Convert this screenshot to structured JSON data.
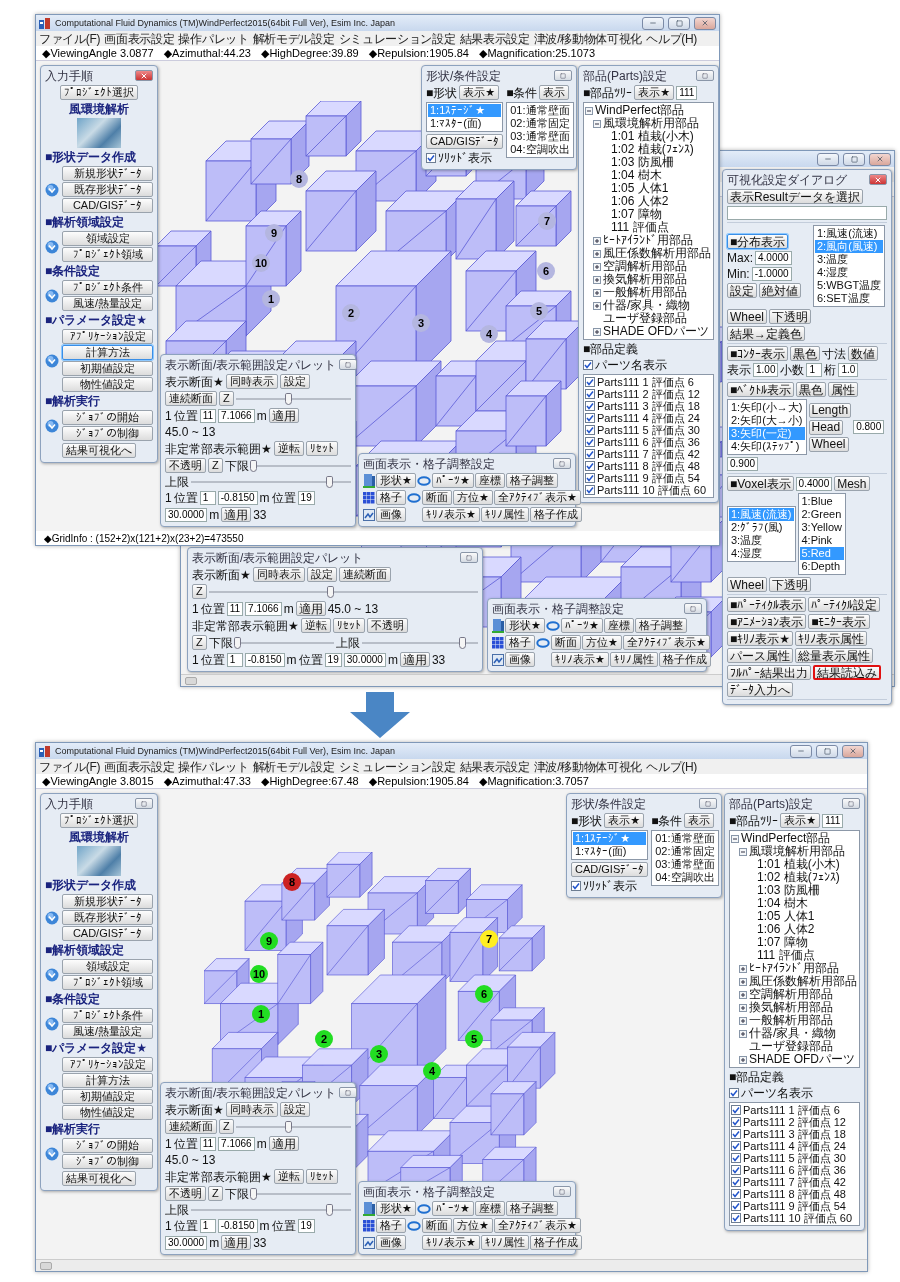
{
  "screens": [
    {
      "title": "Computational Fluid Dynamics (TM)WindPerfect2015(64bit Full Ver), Esim Inc. Japan",
      "menu": [
        "ファイル(F)",
        "画面表示設定",
        "操作パレット",
        "解析モデル設定",
        "シミュレーション設定",
        "結果表示設定",
        "津波/移動物体可視化",
        "ヘルプ(H)"
      ],
      "info": [
        "◆ViewingAngle 3.0877",
        "◆Azimuthal:44.23",
        "◆HighDegree:39.89",
        "◆Repulsion:1905.84",
        "◆Magnification:25.1073"
      ],
      "input_panel": {
        "title": "入力手順",
        "close_highlighted": true,
        "project_button": "ﾌﾟﾛｼﾞｪｸﾄ選択",
        "analysis_type": "風環境解析",
        "sections": [
          {
            "heading": "■形状データ作成",
            "buttons": [
              {
                "label": "新規形状ﾃﾞｰﾀ",
                "selected": false
              },
              {
                "label": "既存形状ﾃﾞｰﾀ",
                "selected": false
              },
              {
                "label": "CAD/GISﾃﾞｰﾀ",
                "selected": false
              }
            ]
          },
          {
            "heading": "■解析領域設定",
            "buttons": [
              {
                "label": "領域設定",
                "selected": false
              },
              {
                "label": "ﾌﾟﾛｼﾞｪｸﾄ領域",
                "selected": false
              }
            ]
          },
          {
            "heading": "■条件設定",
            "buttons": [
              {
                "label": "ﾌﾟﾛｼﾞｪｸﾄ条件",
                "selected": false
              },
              {
                "label": "風速/熱量設定",
                "selected": false
              }
            ]
          },
          {
            "heading": "■パラメータ設定★",
            "buttons": [
              {
                "label": "ｱﾌﾟﾘｹｰｼｮﾝ設定",
                "selected": false
              },
              {
                "label": "計算方法",
                "selected": true
              },
              {
                "label": "初期値設定",
                "selected": false
              },
              {
                "label": "物性値設定",
                "selected": false
              }
            ]
          },
          {
            "heading": "■解析実行",
            "buttons": [
              {
                "label": "ｼﾞｮﾌﾞの開始",
                "selected": false
              },
              {
                "label": "ｼﾞｮﾌﾞの制御",
                "selected": false
              }
            ]
          }
        ],
        "finish_button": "結果可視化へ"
      },
      "shape_panel": {
        "title": "形状/条件設定",
        "shape_heading": "■形状",
        "shape_button": "表示★",
        "condition_heading": "■条件",
        "condition_button": "表示",
        "shapes": [
          {
            "label": "1:1ｽﾃｰｼﾞ★",
            "selected": true
          },
          {
            "label": "1:ﾏｽﾀｰ(面)",
            "selected": false
          }
        ],
        "conditions": [
          {
            "label": "01:通常壁面",
            "selected": false
          },
          {
            "label": "02:通常固定",
            "selected": false
          },
          {
            "label": "03:通常壁面",
            "selected": false
          },
          {
            "label": "04:空調吹出",
            "selected": false
          }
        ],
        "cad_button": "CAD/GISﾃﾞｰﾀ",
        "solid_display": {
          "label": "ｿﾘｯﾄﾞ表示",
          "checked": true
        }
      },
      "parts_panel": {
        "title": "部品(Parts)設定",
        "tree_heading": "■部品ﾂﾘｰ",
        "tree_button": "表示★",
        "filter_value": "111",
        "tree": [
          {
            "label": "WindPerfect部品",
            "expanded": true,
            "children": [
              {
                "label": "風環境解析用部品",
                "expanded": true,
                "children": [
                  {
                    "label": "1:01 植栽(小木)"
                  },
                  {
                    "label": "1:02 植栽(ﾌｪﾝｽ)"
                  },
                  {
                    "label": "1:03 防風柵"
                  },
                  {
                    "label": "1:04 樹木"
                  },
                  {
                    "label": "1:05 人体1"
                  },
                  {
                    "label": "1:06 人体2"
                  },
                  {
                    "label": "1:07 障物"
                  },
                  {
                    "label": "111 評価点"
                  }
                ]
              },
              {
                "label": "ﾋｰﾄｱｲﾗﾝﾄﾞ用部品",
                "expanded": false
              },
              {
                "label": "風圧係数解析用部品",
                "expanded": false
              },
              {
                "label": "空調解析用部品",
                "expanded": false
              },
              {
                "label": "換気解析用部品",
                "expanded": false
              },
              {
                "label": "一般解析用部品",
                "expanded": false
              },
              {
                "label": "什器/家具・織物",
                "expanded": false
              },
              {
                "label": "ユーザ登録部品"
              },
              {
                "label": "SHADE OFDパーツ",
                "expanded": false
              }
            ]
          }
        ],
        "definition_heading": "■部品定義",
        "show_names": {
          "label": "パーツ名表示",
          "checked": true
        },
        "parts": [
          {
            "label": "Parts111 1 評価点 6",
            "checked": true
          },
          {
            "label": "Parts111 2 評価点 12",
            "checked": true
          },
          {
            "label": "Parts111 3 評価点 18",
            "checked": true
          },
          {
            "label": "Parts111 4 評価点 24",
            "checked": true
          },
          {
            "label": "Parts111 5 評価点 30",
            "checked": true
          },
          {
            "label": "Parts111 6 評価点 36",
            "checked": true
          },
          {
            "label": "Parts111 7 評価点 42",
            "checked": true
          },
          {
            "label": "Parts111 8 評価点 48",
            "checked": true
          },
          {
            "label": "Parts111 9 評価点 54",
            "checked": true
          },
          {
            "label": "Parts111 10 評価点 60",
            "checked": true
          }
        ]
      },
      "palette": {
        "title": "表示断面/表示範囲設定パレット",
        "groups": [
          {
            "heading": "表示断面★",
            "buttons": [
              "同時表示",
              "設定",
              "連続断面"
            ],
            "sliders": [
              {
                "z": "Z",
                "level": 0.45
              }
            ],
            "readout": [
              {
                "kind": "text",
                "text": "1"
              },
              {
                "kind": "text",
                "text": "位置"
              },
              {
                "kind": "field",
                "value": "11"
              },
              {
                "kind": "field",
                "value": "7.1066"
              },
              {
                "kind": "text",
                "text": "m"
              },
              {
                "kind": "button",
                "label": "適用"
              },
              {
                "kind": "text",
                "text": "45.0 ~ 13"
              }
            ]
          },
          {
            "heading": "非定常部表示範囲★",
            "buttons": [
              "逆転",
              "ﾘｾｯﾄ",
              "不透明"
            ],
            "sliders": [
              {
                "z": "Z",
                "label": "下限",
                "level": 0.02
              },
              {
                "label": "上限",
                "level": 0.86
              }
            ],
            "readout": [
              {
                "kind": "text",
                "text": "1"
              },
              {
                "kind": "text",
                "text": "位置"
              },
              {
                "kind": "field",
                "value": "1"
              },
              {
                "kind": "field",
                "value": "-0.8150"
              },
              {
                "kind": "text",
                "text": "m"
              },
              {
                "kind": "text",
                "text": "位置"
              },
              {
                "kind": "field",
                "value": "19"
              },
              {
                "kind": "field",
                "value": "30.0000"
              },
              {
                "kind": "text",
                "text": "m"
              },
              {
                "kind": "button",
                "label": "適用"
              },
              {
                "kind": "text",
                "text": "33"
              }
            ]
          }
        ]
      },
      "display_panel": {
        "title": "画面表示・格子調整設定",
        "rows": [
          [
            "形状★",
            "ﾊﾟｰﾂ★",
            "座標",
            "格子調整"
          ],
          [
            "格子",
            "断面",
            "方位★",
            "全ｱｸﾃｨﾌﾞ表示★"
          ],
          [
            "画像",
            "ｷﾘﾉ表示★",
            "ｷﾘﾉ属性",
            "格子作成"
          ]
        ]
      },
      "markers": [
        {
          "label": "1",
          "color": "#b4b6e0"
        },
        {
          "label": "2",
          "color": "#b4b6e0"
        },
        {
          "label": "3",
          "color": "#b4b6e0"
        },
        {
          "label": "4",
          "color": "#b4b6e0"
        },
        {
          "label": "5",
          "color": "#b4b6e0"
        },
        {
          "label": "6",
          "color": "#b4b6e0"
        },
        {
          "label": "7",
          "color": "#b4b6e0"
        },
        {
          "label": "8",
          "color": "#b4b6e0"
        },
        {
          "label": "9",
          "color": "#b4b6e0"
        },
        {
          "label": "10",
          "color": "#b4b6e0"
        }
      ],
      "grid_info": "◆GridInfo : (152+2)x(121+2)x(23+2)=473550"
    },
    {
      "vis_dialog": {
        "title": "可視化設定ダイアログ",
        "close_highlighted": true,
        "groups": [
          {
            "items": [
              {
                "kind": "button",
                "label": "表示Resultデータを選択"
              },
              {
                "kind": "field"
              }
            ]
          },
          {
            "items": [
              {
                "kind": "column",
                "items": [
                  {
                    "kind": "toggle",
                    "label": "■分布表示",
                    "selected": true
                  },
                  {
                    "kind": "text",
                    "text": "Max:"
                  },
                  {
                    "kind": "field",
                    "value": "4.0000"
                  },
                  {
                    "kind": "text",
                    "text": "Min:"
                  },
                  {
                    "kind": "field",
                    "value": "-1.0000"
                  },
                  {
                    "kind": "button",
                    "label": "設定"
                  },
                  {
                    "kind": "button",
                    "label": "絶対値"
                  }
                ]
              },
              {
                "kind": "list",
                "items": [
                  {
                    "label": "1:風速(流速)",
                    "selected": false
                  },
                  {
                    "label": "2:風向(風速)",
                    "selected": true
                  },
                  {
                    "label": "3:温度",
                    "selected": false
                  },
                  {
                    "label": "4:湿度",
                    "selected": false
                  },
                  {
                    "label": "5:WBGT温度",
                    "selected": false
                  },
                  {
                    "label": "6:SET温度",
                    "selected": false
                  }
                ]
              },
              {
                "kind": "button",
                "label": "Wheel"
              },
              {
                "kind": "button",
                "label": "下透明"
              },
              {
                "kind": "button",
                "label": "結果→定義色"
              }
            ]
          },
          {
            "items": [
              {
                "kind": "toggle",
                "label": "■ｺﾝﾀｰ表示",
                "selected": false
              },
              {
                "kind": "button",
                "label": "黒色"
              },
              {
                "kind": "text",
                "text": "寸法"
              },
              {
                "kind": "button",
                "label": "数値"
              },
              {
                "kind": "text",
                "text": "表示"
              },
              {
                "kind": "field",
                "value": "1.00"
              },
              {
                "kind": "text",
                "text": "小数"
              },
              {
                "kind": "field",
                "value": "1"
              },
              {
                "kind": "text",
                "text": "桁"
              },
              {
                "kind": "field",
                "value": "1.0"
              }
            ]
          },
          {
            "items": [
              {
                "kind": "toggle",
                "label": "■ﾍﾞｸﾄﾙ表示",
                "selected": false
              },
              {
                "kind": "button",
                "label": "黒色"
              },
              {
                "kind": "button",
                "label": "属性"
              },
              {
                "kind": "list",
                "items": [
                  {
                    "label": "1:矢印(小→大)",
                    "selected": false
                  },
                  {
                    "label": "2:矢印(大→小)",
                    "selected": false
                  },
                  {
                    "label": "3:矢印(一定)",
                    "selected": true
                  },
                  {
                    "label": "4:矢印(ｽﾃｯﾌﾟ)",
                    "selected": false
                  }
                ]
              },
              {
                "kind": "stack",
                "items": [
                  {
                    "kind": "button",
                    "label": "Length"
                  },
                  {
                    "kind": "button",
                    "label": "Head"
                  },
                  {
                    "kind": "button",
                    "label": "Wheel"
                  }
                ]
              },
              {
                "kind": "field",
                "value": "0.800"
              },
              {
                "kind": "field",
                "value": "0.900"
              }
            ]
          },
          {
            "items": [
              {
                "kind": "toggle",
                "label": "■Voxel表示",
                "selected": false
              },
              {
                "kind": "field",
                "value": "0.4000"
              },
              {
                "kind": "button",
                "label": "Mesh"
              },
              {
                "kind": "list",
                "items": [
                  {
                    "label": "1:風速(流速)",
                    "selected": true
                  },
                  {
                    "label": "2:ｸﾞﾗﾌ(風)",
                    "selected": false
                  },
                  {
                    "label": "3:温度",
                    "selected": false
                  },
                  {
                    "label": "4:湿度",
                    "selected": false
                  }
                ]
              },
              {
                "kind": "list",
                "items": [
                  {
                    "label": "1:Blue",
                    "selected": false
                  },
                  {
                    "label": "2:Green",
                    "selected": false
                  },
                  {
                    "label": "3:Yellow",
                    "selected": false
                  },
                  {
                    "label": "4:Pink",
                    "selected": false
                  },
                  {
                    "label": "5:Red",
                    "selected": true
                  },
                  {
                    "label": "6:Depth",
                    "selected": false
                  }
                ]
              },
              {
                "kind": "button",
                "label": "Wheel"
              },
              {
                "kind": "button",
                "label": "下透明"
              }
            ]
          },
          {
            "items": [
              {
                "kind": "button",
                "label": "■ﾊﾟｰﾃｨｸﾙ表示"
              },
              {
                "kind": "button",
                "label": "ﾊﾟｰﾃｨｸﾙ設定"
              },
              {
                "kind": "button",
                "label": "■ｱﾆﾒｰｼｮﾝ表示"
              },
              {
                "kind": "button",
                "label": "■ﾓﾆﾀｰ表示"
              },
              {
                "kind": "button",
                "label": "■ｷﾘﾉ表示★"
              },
              {
                "kind": "button",
                "label": "ｷﾘﾉ表示属性"
              },
              {
                "kind": "button",
                "label": "パース属性"
              },
              {
                "kind": "button",
                "label": "総量表示属性"
              },
              {
                "kind": "button",
                "label": "ﾌﾙﾊﾟｰ結果出力"
              },
              {
                "kind": "highlighted_button",
                "label": "結果読込み"
              },
              {
                "kind": "button",
                "label": "ﾃﾞｰﾀ入力へ"
              }
            ]
          }
        ]
      },
      "palette": {
        "title": "表示断面/表示範囲設定パレット",
        "groups": [
          {
            "heading": "表示断面★",
            "buttons": [
              "同時表示",
              "設定",
              "連続断面"
            ],
            "sliders": [
              {
                "z": "Z",
                "level": 0.45
              }
            ],
            "readout": [
              {
                "kind": "text",
                "text": "1"
              },
              {
                "kind": "text",
                "text": "位置"
              },
              {
                "kind": "field",
                "value": "11"
              },
              {
                "kind": "field",
                "value": "7.1066"
              },
              {
                "kind": "text",
                "text": "m"
              },
              {
                "kind": "button",
                "label": "適用"
              },
              {
                "kind": "text",
                "text": "45.0 ~ 13"
              }
            ]
          },
          {
            "heading": "非定常部表示範囲★",
            "buttons": [
              "逆転",
              "ﾘｾｯﾄ",
              "不透明"
            ],
            "sliders": [
              {
                "z": "Z",
                "label": "下限",
                "level": 0.02
              },
              {
                "label": "上限",
                "level": 0.86
              }
            ],
            "readout": [
              {
                "kind": "text",
                "text": "1"
              },
              {
                "kind": "text",
                "text": "位置"
              },
              {
                "kind": "field",
                "value": "1"
              },
              {
                "kind": "field",
                "value": "-0.8150"
              },
              {
                "kind": "text",
                "text": "m"
              },
              {
                "kind": "text",
                "text": "位置"
              },
              {
                "kind": "field",
                "value": "19"
              },
              {
                "kind": "field",
                "value": "30.0000"
              },
              {
                "kind": "text",
                "text": "m"
              },
              {
                "kind": "button",
                "label": "適用"
              },
              {
                "kind": "text",
                "text": "33"
              }
            ]
          }
        ]
      },
      "display_panel": {
        "title": "画面表示・格子調整設定",
        "rows": [
          [
            "形状★",
            "ﾊﾟｰﾂ★",
            "座標",
            "格子調整"
          ],
          [
            "格子",
            "断面",
            "方位★",
            "全ｱｸﾃｨﾌﾞ表示★"
          ],
          [
            "画像",
            "ｷﾘﾉ表示★",
            "ｷﾘﾉ属性",
            "格子作成"
          ]
        ]
      }
    },
    {
      "title": "Computational Fluid Dynamics (TM)WindPerfect2015(64bit Full Ver), Esim Inc. Japan",
      "menu": [
        "ファイル(F)",
        "画面表示設定",
        "操作パレット",
        "解析モデル設定",
        "シミュレーション設定",
        "結果表示設定",
        "津波/移動物体可視化",
        "ヘルプ(H)"
      ],
      "info": [
        "◆ViewingAngle 3.8015",
        "◆Azimuthal:47.33",
        "◆HighDegree:67.48",
        "◆Repulsion:1905.84",
        "◆Magnification:3.7057"
      ],
      "input_panel": {
        "title": "入力手順",
        "close_highlighted": false,
        "project_button": "ﾌﾟﾛｼﾞｪｸﾄ選択",
        "analysis_type": "風環境解析",
        "sections": [
          {
            "heading": "■形状データ作成",
            "buttons": [
              {
                "label": "新規形状ﾃﾞｰﾀ",
                "selected": false
              },
              {
                "label": "既存形状ﾃﾞｰﾀ",
                "selected": false
              },
              {
                "label": "CAD/GISﾃﾞｰﾀ",
                "selected": false
              }
            ]
          },
          {
            "heading": "■解析領域設定",
            "buttons": [
              {
                "label": "領域設定",
                "selected": false
              },
              {
                "label": "ﾌﾟﾛｼﾞｪｸﾄ領域",
                "selected": false
              }
            ]
          },
          {
            "heading": "■条件設定",
            "buttons": [
              {
                "label": "ﾌﾟﾛｼﾞｪｸﾄ条件",
                "selected": false
              },
              {
                "label": "風速/熱量設定",
                "selected": false
              }
            ]
          },
          {
            "heading": "■パラメータ設定★",
            "buttons": [
              {
                "label": "ｱﾌﾟﾘｹｰｼｮﾝ設定",
                "selected": false
              },
              {
                "label": "計算方法",
                "selected": false
              },
              {
                "label": "初期値設定",
                "selected": false
              },
              {
                "label": "物性値設定",
                "selected": false
              }
            ]
          },
          {
            "heading": "■解析実行",
            "buttons": [
              {
                "label": "ｼﾞｮﾌﾞの開始",
                "selected": false
              },
              {
                "label": "ｼﾞｮﾌﾞの制御",
                "selected": false
              }
            ]
          }
        ],
        "finish_button": "結果可視化へ"
      },
      "shape_panel": {
        "title": "形状/条件設定",
        "shape_heading": "■形状",
        "shape_button": "表示★",
        "condition_heading": "■条件",
        "condition_button": "表示",
        "shapes": [
          {
            "label": "1:1ｽﾃｰｼﾞ★",
            "selected": true
          },
          {
            "label": "1:ﾏｽﾀｰ(面)",
            "selected": false
          }
        ],
        "conditions": [
          {
            "label": "01:通常壁面",
            "selected": false
          },
          {
            "label": "02:通常固定",
            "selected": false
          },
          {
            "label": "03:通常壁面",
            "selected": false
          },
          {
            "label": "04:空調吹出",
            "selected": false
          }
        ],
        "cad_button": "CAD/GISﾃﾞｰﾀ",
        "solid_display": {
          "label": "ｿﾘｯﾄﾞ表示",
          "checked": true
        }
      },
      "parts_panel": {
        "title": "部品(Parts)設定",
        "tree_heading": "■部品ﾂﾘｰ",
        "tree_button": "表示★",
        "filter_value": "111",
        "tree": [
          {
            "label": "WindPerfect部品",
            "expanded": true,
            "children": [
              {
                "label": "風環境解析用部品",
                "expanded": true,
                "children": [
                  {
                    "label": "1:01 植栽(小木)"
                  },
                  {
                    "label": "1:02 植栽(ﾌｪﾝｽ)"
                  },
                  {
                    "label": "1:03 防風柵"
                  },
                  {
                    "label": "1:04 樹木"
                  },
                  {
                    "label": "1:05 人体1"
                  },
                  {
                    "label": "1:06 人体2"
                  },
                  {
                    "label": "1:07 障物"
                  },
                  {
                    "label": "111 評価点"
                  }
                ]
              },
              {
                "label": "ﾋｰﾄｱｲﾗﾝﾄﾞ用部品",
                "expanded": false
              },
              {
                "label": "風圧係数解析用部品",
                "expanded": false
              },
              {
                "label": "空調解析用部品",
                "expanded": false
              },
              {
                "label": "換気解析用部品",
                "expanded": false
              },
              {
                "label": "一般解析用部品",
                "expanded": false
              },
              {
                "label": "什器/家具・織物",
                "expanded": false
              },
              {
                "label": "ユーザ登録部品"
              },
              {
                "label": "SHADE OFDパーツ",
                "expanded": false
              }
            ]
          }
        ],
        "definition_heading": "■部品定義",
        "show_names": {
          "label": "パーツ名表示",
          "checked": true
        },
        "parts": [
          {
            "label": "Parts111 1 評価点 6",
            "checked": true
          },
          {
            "label": "Parts111 2 評価点 12",
            "checked": true
          },
          {
            "label": "Parts111 3 評価点 18",
            "checked": true
          },
          {
            "label": "Parts111 4 評価点 24",
            "checked": true
          },
          {
            "label": "Parts111 5 評価点 30",
            "checked": true
          },
          {
            "label": "Parts111 6 評価点 36",
            "checked": true
          },
          {
            "label": "Parts111 7 評価点 42",
            "checked": true
          },
          {
            "label": "Parts111 8 評価点 48",
            "checked": true
          },
          {
            "label": "Parts111 9 評価点 54",
            "checked": true
          },
          {
            "label": "Parts111 10 評価点 60",
            "checked": true
          }
        ]
      },
      "palette": {
        "title": "表示断面/表示範囲設定パレット",
        "groups": [
          {
            "heading": "表示断面★",
            "buttons": [
              "同時表示",
              "設定",
              "連続断面"
            ],
            "sliders": [
              {
                "z": "Z",
                "level": 0.45
              }
            ],
            "readout": [
              {
                "kind": "text",
                "text": "1"
              },
              {
                "kind": "text",
                "text": "位置"
              },
              {
                "kind": "field",
                "value": "11"
              },
              {
                "kind": "field",
                "value": "7.1066"
              },
              {
                "kind": "text",
                "text": "m"
              },
              {
                "kind": "button",
                "label": "適用"
              },
              {
                "kind": "text",
                "text": "45.0 ~ 13"
              }
            ]
          },
          {
            "heading": "非定常部表示範囲★",
            "buttons": [
              "逆転",
              "ﾘｾｯﾄ",
              "不透明"
            ],
            "sliders": [
              {
                "z": "Z",
                "label": "下限",
                "level": 0.02
              },
              {
                "label": "上限",
                "level": 0.86
              }
            ],
            "readout": [
              {
                "kind": "text",
                "text": "1"
              },
              {
                "kind": "text",
                "text": "位置"
              },
              {
                "kind": "field",
                "value": "1"
              },
              {
                "kind": "field",
                "value": "-0.8150"
              },
              {
                "kind": "text",
                "text": "m"
              },
              {
                "kind": "text",
                "text": "位置"
              },
              {
                "kind": "field",
                "value": "19"
              },
              {
                "kind": "field",
                "value": "30.0000"
              },
              {
                "kind": "text",
                "text": "m"
              },
              {
                "kind": "button",
                "label": "適用"
              },
              {
                "kind": "text",
                "text": "33"
              }
            ]
          }
        ]
      },
      "display_panel": {
        "title": "画面表示・格子調整設定",
        "rows": [
          [
            "形状★",
            "ﾊﾟｰﾂ★",
            "座標",
            "格子調整"
          ],
          [
            "格子",
            "断面",
            "方位★",
            "全ｱｸﾃｨﾌﾞ表示★"
          ],
          [
            "画像",
            "ｷﾘﾉ表示★",
            "ｷﾘﾉ属性",
            "格子作成"
          ]
        ]
      },
      "markers": [
        {
          "label": "1",
          "color": "#22dd22"
        },
        {
          "label": "2",
          "color": "#22dd22"
        },
        {
          "label": "3",
          "color": "#22dd22"
        },
        {
          "label": "4",
          "color": "#22dd22"
        },
        {
          "label": "5",
          "color": "#22dd22"
        },
        {
          "label": "6",
          "color": "#22dd22"
        },
        {
          "label": "7",
          "color": "#ffee22"
        },
        {
          "label": "8",
          "color": "#cc2222"
        },
        {
          "label": "9",
          "color": "#22dd22"
        },
        {
          "label": "10",
          "color": "#22dd22"
        }
      ]
    }
  ]
}
